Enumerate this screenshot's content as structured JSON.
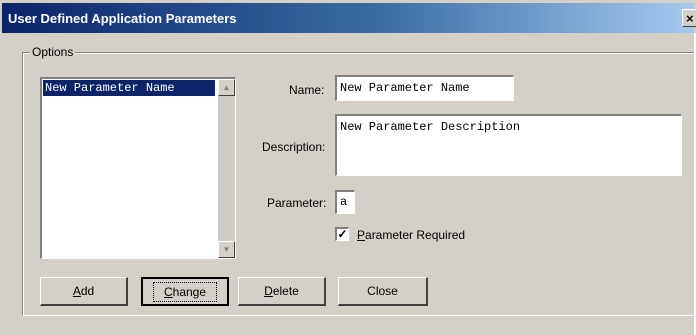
{
  "window": {
    "title": "User Defined Application Parameters",
    "close_glyph": "×"
  },
  "options": {
    "group_label": "Options",
    "list_items": [
      "New Parameter Name"
    ],
    "selected_index": 0
  },
  "form": {
    "name_label": "Name:",
    "name_value": "New Parameter Name",
    "description_label": "Description:",
    "description_value": "New Parameter Description",
    "parameter_label": "Parameter:",
    "parameter_value": "a",
    "required_label_accel": "P",
    "required_label_rest": "arameter Required",
    "required_checked": true
  },
  "buttons": {
    "add_accel": "A",
    "add_rest": "dd",
    "change_accel": "C",
    "change_rest": "hange",
    "delete_accel": "D",
    "delete_rest": "elete",
    "close": "Close"
  },
  "colors": {
    "titlebar_start": "#0a246a",
    "titlebar_end": "#a6caf0",
    "face": "#d4d0c8",
    "selection": "#0a246a"
  }
}
